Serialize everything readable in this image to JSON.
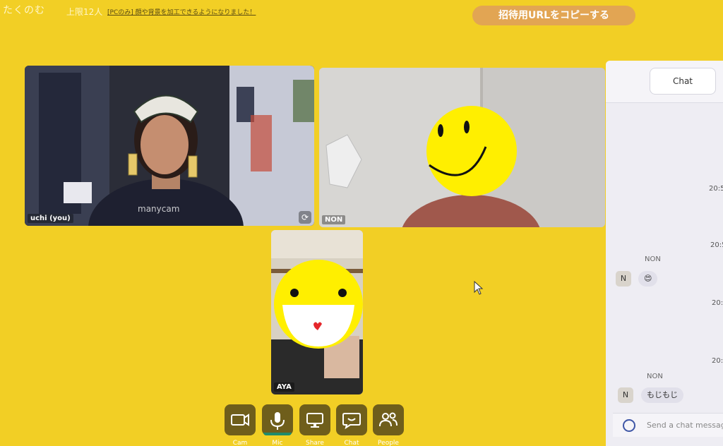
{
  "header": {
    "room_name": "たくのむ",
    "capacity": "上限12人",
    "notice": "[PCのみ] 顔や背景を加工できるようになりました！",
    "invite_button": "招待用URLをコピーする"
  },
  "participants": [
    {
      "name": "uchi (you)",
      "watermark": "manycam"
    },
    {
      "name": "NON"
    },
    {
      "name": "AYA"
    }
  ],
  "toolbar": {
    "cam": "Cam",
    "mic": "Mic",
    "share": "Share",
    "chat": "Chat",
    "people": "People"
  },
  "chat": {
    "tab_label": "Chat",
    "timestamps": [
      "20:5",
      "20:5",
      "20:",
      "20:"
    ],
    "messages": [
      {
        "sender": "NON",
        "avatar": "N",
        "text": "😍"
      },
      {
        "sender": "NON",
        "avatar": "N",
        "text": "もじもじ"
      }
    ],
    "input_placeholder": "Send a chat message"
  },
  "colors": {
    "background": "#f2cf25",
    "invite_button": "#e2a553",
    "toolbar_button": "#6f5e1b",
    "mic_active": "#1f8b6c"
  },
  "icons": [
    "camera-icon",
    "microphone-icon",
    "monitor-icon",
    "chat-bubble-icon",
    "people-icon",
    "camera-flip-icon",
    "emoji-icon",
    "mouse-cursor-icon"
  ]
}
